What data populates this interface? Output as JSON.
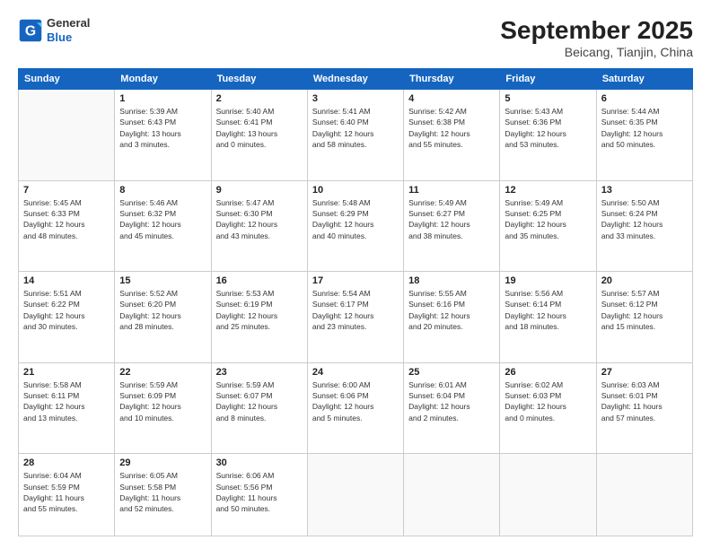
{
  "header": {
    "logo_general": "General",
    "logo_blue": "Blue",
    "month_title": "September 2025",
    "location": "Beicang, Tianjin, China"
  },
  "weekdays": [
    "Sunday",
    "Monday",
    "Tuesday",
    "Wednesday",
    "Thursday",
    "Friday",
    "Saturday"
  ],
  "weeks": [
    [
      {
        "day": "",
        "info": ""
      },
      {
        "day": "1",
        "info": "Sunrise: 5:39 AM\nSunset: 6:43 PM\nDaylight: 13 hours\nand 3 minutes."
      },
      {
        "day": "2",
        "info": "Sunrise: 5:40 AM\nSunset: 6:41 PM\nDaylight: 13 hours\nand 0 minutes."
      },
      {
        "day": "3",
        "info": "Sunrise: 5:41 AM\nSunset: 6:40 PM\nDaylight: 12 hours\nand 58 minutes."
      },
      {
        "day": "4",
        "info": "Sunrise: 5:42 AM\nSunset: 6:38 PM\nDaylight: 12 hours\nand 55 minutes."
      },
      {
        "day": "5",
        "info": "Sunrise: 5:43 AM\nSunset: 6:36 PM\nDaylight: 12 hours\nand 53 minutes."
      },
      {
        "day": "6",
        "info": "Sunrise: 5:44 AM\nSunset: 6:35 PM\nDaylight: 12 hours\nand 50 minutes."
      }
    ],
    [
      {
        "day": "7",
        "info": "Sunrise: 5:45 AM\nSunset: 6:33 PM\nDaylight: 12 hours\nand 48 minutes."
      },
      {
        "day": "8",
        "info": "Sunrise: 5:46 AM\nSunset: 6:32 PM\nDaylight: 12 hours\nand 45 minutes."
      },
      {
        "day": "9",
        "info": "Sunrise: 5:47 AM\nSunset: 6:30 PM\nDaylight: 12 hours\nand 43 minutes."
      },
      {
        "day": "10",
        "info": "Sunrise: 5:48 AM\nSunset: 6:29 PM\nDaylight: 12 hours\nand 40 minutes."
      },
      {
        "day": "11",
        "info": "Sunrise: 5:49 AM\nSunset: 6:27 PM\nDaylight: 12 hours\nand 38 minutes."
      },
      {
        "day": "12",
        "info": "Sunrise: 5:49 AM\nSunset: 6:25 PM\nDaylight: 12 hours\nand 35 minutes."
      },
      {
        "day": "13",
        "info": "Sunrise: 5:50 AM\nSunset: 6:24 PM\nDaylight: 12 hours\nand 33 minutes."
      }
    ],
    [
      {
        "day": "14",
        "info": "Sunrise: 5:51 AM\nSunset: 6:22 PM\nDaylight: 12 hours\nand 30 minutes."
      },
      {
        "day": "15",
        "info": "Sunrise: 5:52 AM\nSunset: 6:20 PM\nDaylight: 12 hours\nand 28 minutes."
      },
      {
        "day": "16",
        "info": "Sunrise: 5:53 AM\nSunset: 6:19 PM\nDaylight: 12 hours\nand 25 minutes."
      },
      {
        "day": "17",
        "info": "Sunrise: 5:54 AM\nSunset: 6:17 PM\nDaylight: 12 hours\nand 23 minutes."
      },
      {
        "day": "18",
        "info": "Sunrise: 5:55 AM\nSunset: 6:16 PM\nDaylight: 12 hours\nand 20 minutes."
      },
      {
        "day": "19",
        "info": "Sunrise: 5:56 AM\nSunset: 6:14 PM\nDaylight: 12 hours\nand 18 minutes."
      },
      {
        "day": "20",
        "info": "Sunrise: 5:57 AM\nSunset: 6:12 PM\nDaylight: 12 hours\nand 15 minutes."
      }
    ],
    [
      {
        "day": "21",
        "info": "Sunrise: 5:58 AM\nSunset: 6:11 PM\nDaylight: 12 hours\nand 13 minutes."
      },
      {
        "day": "22",
        "info": "Sunrise: 5:59 AM\nSunset: 6:09 PM\nDaylight: 12 hours\nand 10 minutes."
      },
      {
        "day": "23",
        "info": "Sunrise: 5:59 AM\nSunset: 6:07 PM\nDaylight: 12 hours\nand 8 minutes."
      },
      {
        "day": "24",
        "info": "Sunrise: 6:00 AM\nSunset: 6:06 PM\nDaylight: 12 hours\nand 5 minutes."
      },
      {
        "day": "25",
        "info": "Sunrise: 6:01 AM\nSunset: 6:04 PM\nDaylight: 12 hours\nand 2 minutes."
      },
      {
        "day": "26",
        "info": "Sunrise: 6:02 AM\nSunset: 6:03 PM\nDaylight: 12 hours\nand 0 minutes."
      },
      {
        "day": "27",
        "info": "Sunrise: 6:03 AM\nSunset: 6:01 PM\nDaylight: 11 hours\nand 57 minutes."
      }
    ],
    [
      {
        "day": "28",
        "info": "Sunrise: 6:04 AM\nSunset: 5:59 PM\nDaylight: 11 hours\nand 55 minutes."
      },
      {
        "day": "29",
        "info": "Sunrise: 6:05 AM\nSunset: 5:58 PM\nDaylight: 11 hours\nand 52 minutes."
      },
      {
        "day": "30",
        "info": "Sunrise: 6:06 AM\nSunset: 5:56 PM\nDaylight: 11 hours\nand 50 minutes."
      },
      {
        "day": "",
        "info": ""
      },
      {
        "day": "",
        "info": ""
      },
      {
        "day": "",
        "info": ""
      },
      {
        "day": "",
        "info": ""
      }
    ]
  ]
}
